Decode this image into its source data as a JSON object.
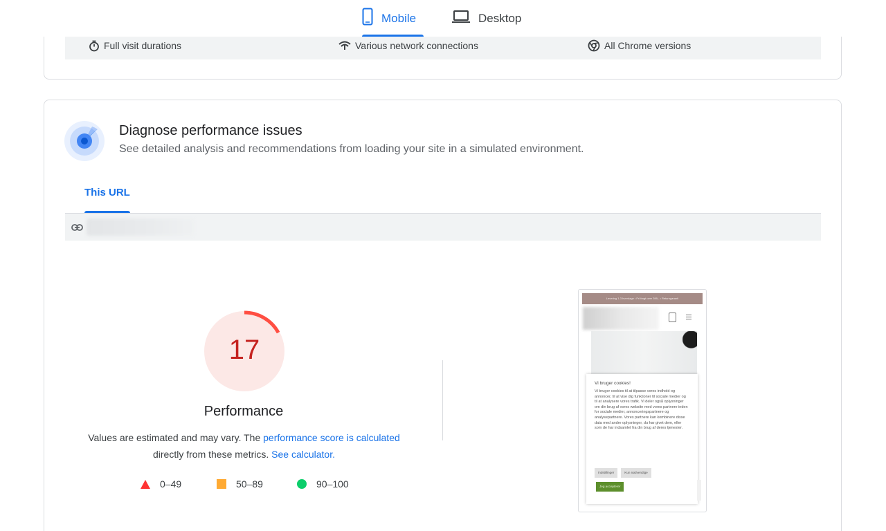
{
  "device_tabs": {
    "mobile_label": "Mobile",
    "desktop_label": "Desktop",
    "active": "mobile"
  },
  "features": [
    {
      "icon": "stopwatch-icon",
      "label": "Full visit durations"
    },
    {
      "icon": "network-icon",
      "label": "Various network connections"
    },
    {
      "icon": "chrome-icon",
      "label": "All Chrome versions"
    }
  ],
  "diagnose": {
    "title": "Diagnose performance issues",
    "subtitle": "See detailed analysis and recommendations from loading your site in a simulated environment."
  },
  "url_tabs": {
    "active_label": "This URL"
  },
  "performance": {
    "score": 17,
    "score_text": "17",
    "title": "Performance",
    "note_prefix": "Values are estimated and may vary. The ",
    "note_link1": "performance score is calculated",
    "note_middle": " directly from these metrics. ",
    "note_link2": "See calculator.",
    "score_color": "#c5221f",
    "ring_color": "#ff4e42",
    "ring_bg": "#fce8e6"
  },
  "legend": [
    {
      "shape": "triangle",
      "color": "#ff3333",
      "label": "0–49"
    },
    {
      "shape": "square",
      "color": "#ffaa33",
      "label": "50–89"
    },
    {
      "shape": "circle",
      "color": "#0cce6b",
      "label": "90–100"
    }
  ],
  "screenshot": {
    "banner": "Levering 1-3 hverdage • Fri fragt over 399,- • Returngaranti",
    "dialog_title": "Vi bruger cookies!",
    "dialog_body": "Vi bruger cookies til at tilpasse vores indhold og annoncer, til at vise dig funktioner til sociale medier og til at analysere vores trafik. Vi deler også oplysninger om din brug af vores website med vores partnere inden for sociale medier, annonceringspartnere og analysepartnere. Vores partnere kan kombinere disse data med andre oplysninger, du har givet dem, eller som de har indsamlet fra din brug af deres tjenester.",
    "btn_settings": "Indstillinger",
    "btn_necessary": "Kun nødvendige",
    "btn_accept": "Jeg accepterer"
  },
  "colors": {
    "accent": "#1a73e8",
    "border": "#dadce0",
    "strip": "#f1f3f4"
  }
}
